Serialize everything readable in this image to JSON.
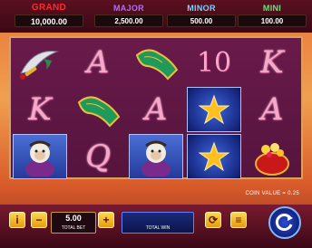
{
  "jackpots": {
    "grand": {
      "label": "GRAND",
      "value": "10,000.00"
    },
    "major": {
      "label": "MAJOR",
      "value": "2,500.00"
    },
    "minor": {
      "label": "MINOR",
      "value": "500.00"
    },
    "mini": {
      "label": "MINI",
      "value": "100.00"
    }
  },
  "reels": {
    "row1": [
      "sword",
      "A",
      "carpet",
      "10",
      "K"
    ],
    "row2": [
      "K",
      "carpet",
      "A",
      "star",
      "A"
    ],
    "row3": [
      "monkey",
      "Q",
      "monkey",
      "star",
      "treasure-pot"
    ]
  },
  "coin_value": "COIN VALUE = 0.25",
  "bet": {
    "value": "5.00",
    "label": "TOTAL BET"
  },
  "win": {
    "label": "TOTAL WIN"
  },
  "colors": {
    "accent": "#ffd84a",
    "reel_bg": "#6a1a4a",
    "spin": "#2a4ad0"
  }
}
